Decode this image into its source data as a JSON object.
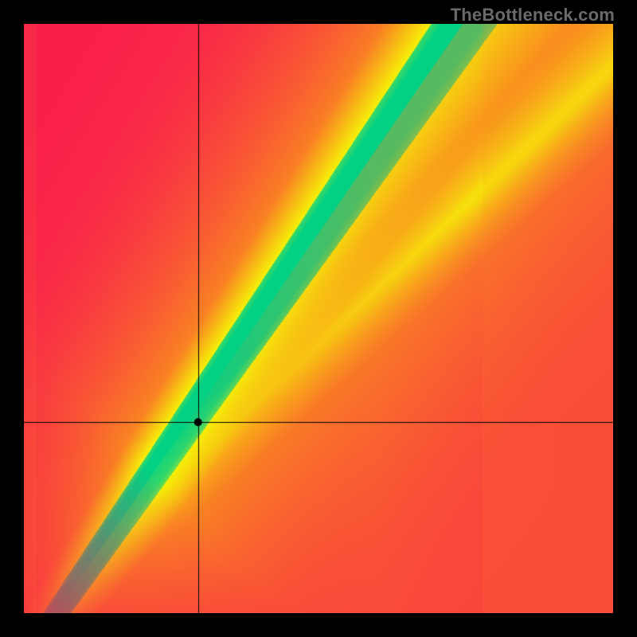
{
  "watermark": "TheBottleneck.com",
  "chart_data": {
    "type": "heatmap",
    "title": "",
    "xlabel": "",
    "ylabel": "",
    "xlim": [
      0,
      1
    ],
    "ylim": [
      0,
      1
    ],
    "crosshair": {
      "x": 0.296,
      "y": 0.323
    },
    "point": {
      "x": 0.296,
      "y": 0.323
    },
    "optimal_band": {
      "description": "green diagonal band (slope ~1.45) is optimal; value falls off to yellow then red away from band, with extra bottom-left and top-right yellow corners",
      "slope": 1.45,
      "intercept": -0.08,
      "green_halfwidth": 0.035,
      "yellow_halfwidth": 0.095
    },
    "colors": {
      "green": "#02d184",
      "yellow": "#f6f108",
      "orange": "#f98f1e",
      "red": "#f91f4b",
      "crosshair": "#000000",
      "dot": "#000000",
      "background": "#000000"
    }
  }
}
